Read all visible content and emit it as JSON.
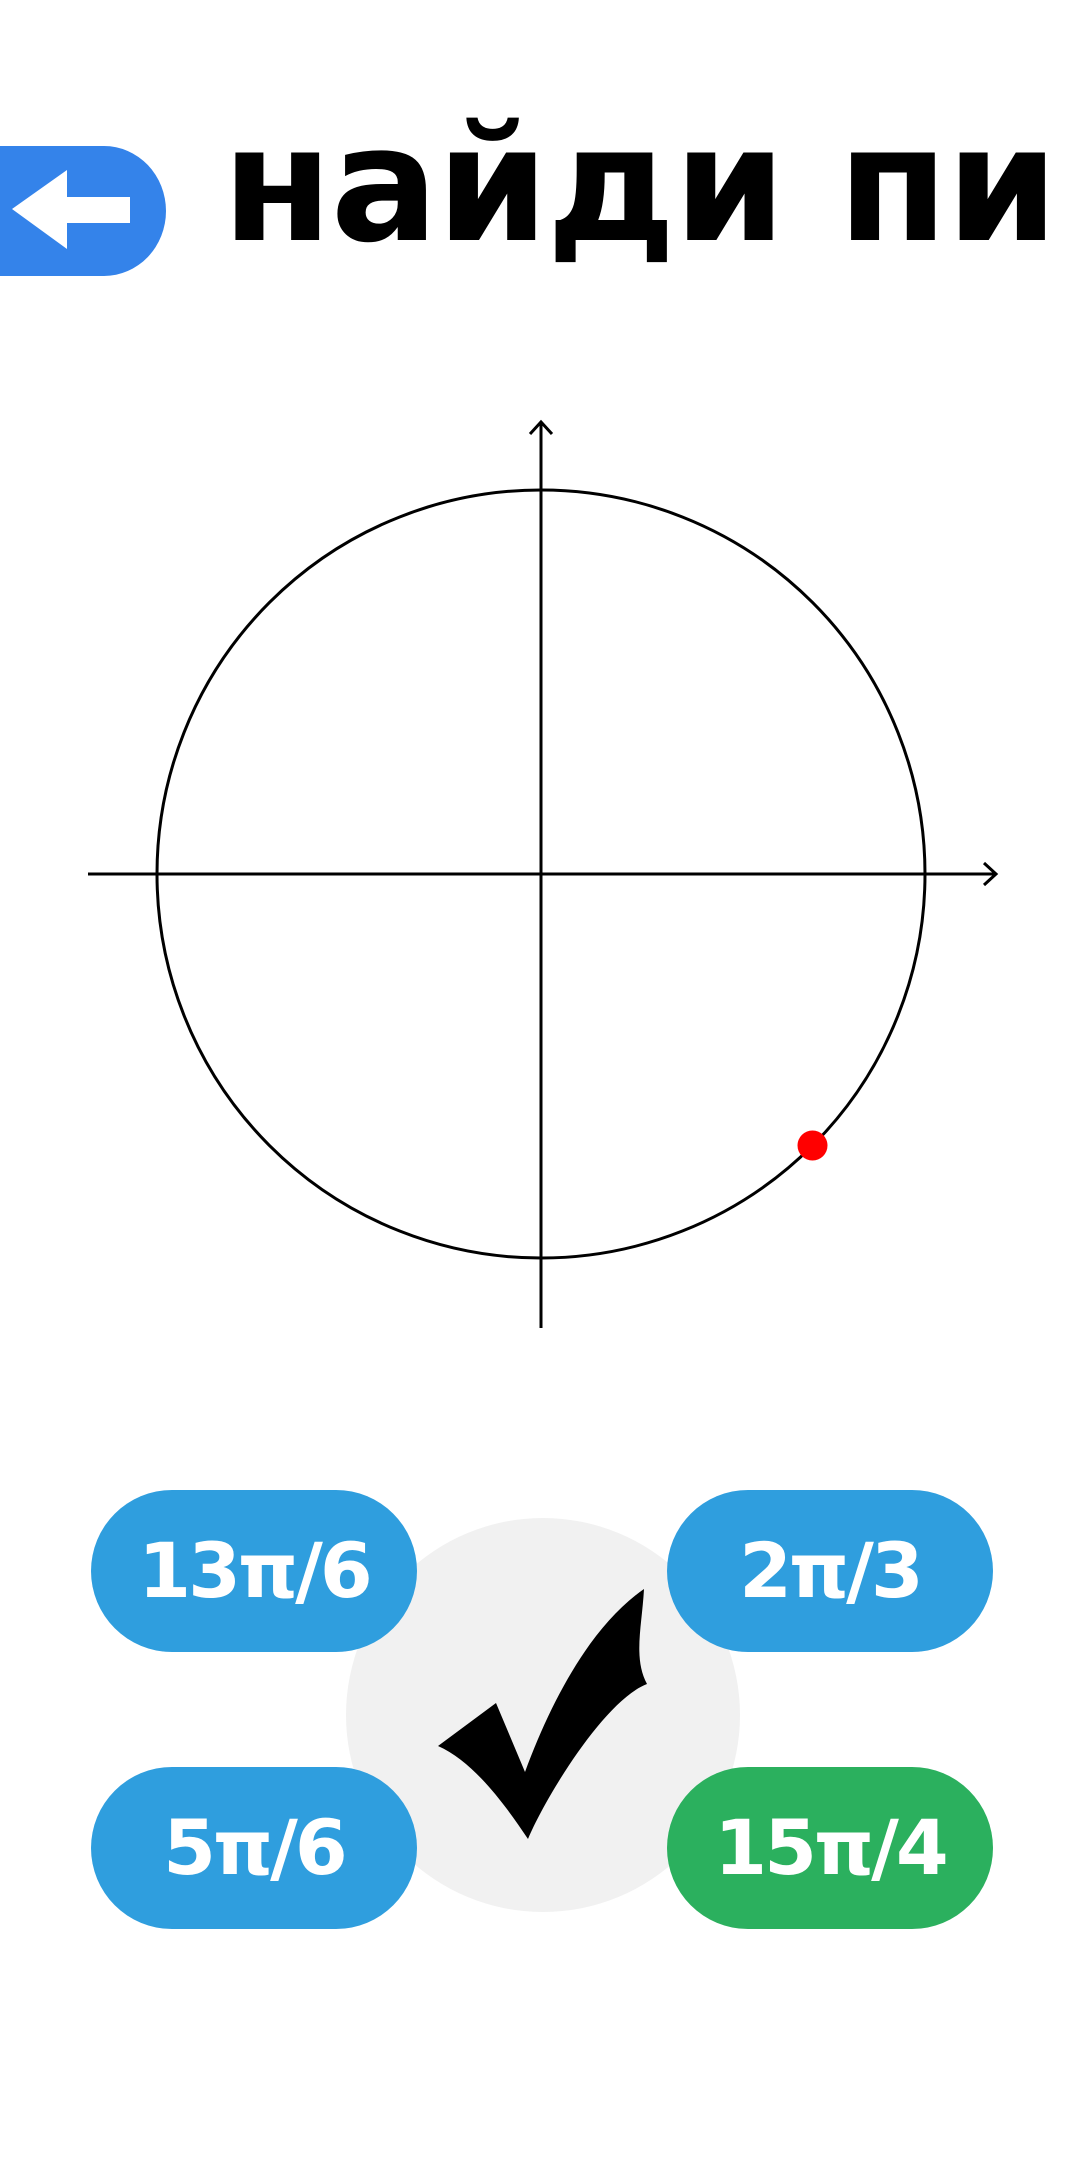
{
  "header": {
    "title": "найди пи",
    "back_icon": "arrow-left-icon",
    "back_color": "#3483ea"
  },
  "unit_circle": {
    "point_color": "#ff0000",
    "point_angle_deg": -45
  },
  "confirm": {
    "icon": "checkmark-icon",
    "background_color": "#f1f1f1"
  },
  "answers": [
    {
      "label": "13π/6",
      "color": "#2f9ede",
      "state": "default"
    },
    {
      "label": "2π/3",
      "color": "#2f9ede",
      "state": "default"
    },
    {
      "label": "5π/6",
      "color": "#2f9ede",
      "state": "default"
    },
    {
      "label": "15π/4",
      "color": "#2bb05e",
      "state": "selected"
    }
  ]
}
